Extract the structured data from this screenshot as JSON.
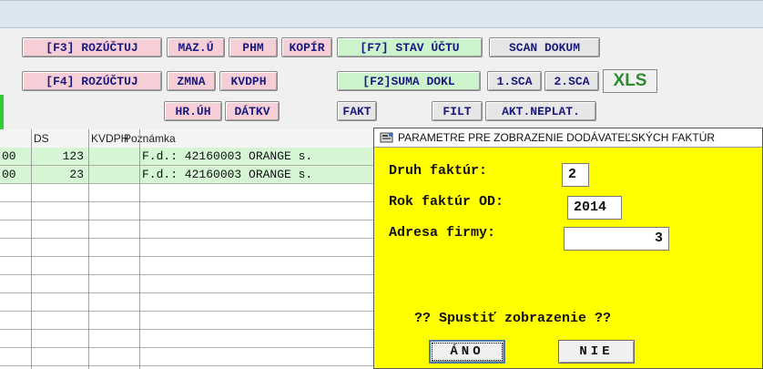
{
  "toolbar": {
    "row1": {
      "rozuctuj_f3": "[F3] ROZÚČTUJ",
      "maz_u": "MAZ.Ú",
      "phm": "PHM",
      "kopir": "KOPÍR",
      "stav_uctu": "[F7] STAV ÚČTU",
      "scan_dokum": "SCAN DOKUM"
    },
    "row2": {
      "rozuctuj_f4": "[F4] ROZÚČTUJ",
      "zmna": "ZMNA",
      "kvdph": "KVDPH",
      "suma_dokl": "[F2]SUMA DOKL",
      "scan1": "1.SCA",
      "scan2": "2.SCA",
      "xls": "XLS"
    },
    "row3": {
      "hr_uh": "HR.ÚH",
      "datkv": "DÁTKV",
      "fakt": "FAKT",
      "filt": "FILT",
      "akt_neplat": "AKT.NEPLAT."
    }
  },
  "grid": {
    "columns": [
      "DS",
      "KVDPH",
      "Poznámka"
    ],
    "rows": [
      {
        "lead": "00",
        "ds": "123",
        "kvdph": "",
        "poznamka": "F.d.:  42160003 ORANGE s."
      },
      {
        "lead": "00",
        "ds": "23",
        "kvdph": "",
        "poznamka": "F.d.:  42160003 ORANGE s."
      }
    ]
  },
  "dialog": {
    "title": "PARAMETRE PRE ZOBRAZENIE DODÁVATEĽSKÝCH FAKTÚR",
    "fields": {
      "druh_label": "Druh faktúr:",
      "druh_value": "2",
      "rok_label": "Rok faktúr OD:",
      "rok_value": "2014",
      "adresa_label": "Adresa firmy:",
      "adresa_value": "3"
    },
    "question": "?? Spustiť zobrazenie ??",
    "ano_label": "ÁNO",
    "nie_label": "NIE"
  },
  "colors": {
    "pink_button": "#f6cfd6",
    "green_button": "#cdf3cd",
    "dialog_bg": "#ffff00",
    "xls_text": "#2e8b2e"
  }
}
